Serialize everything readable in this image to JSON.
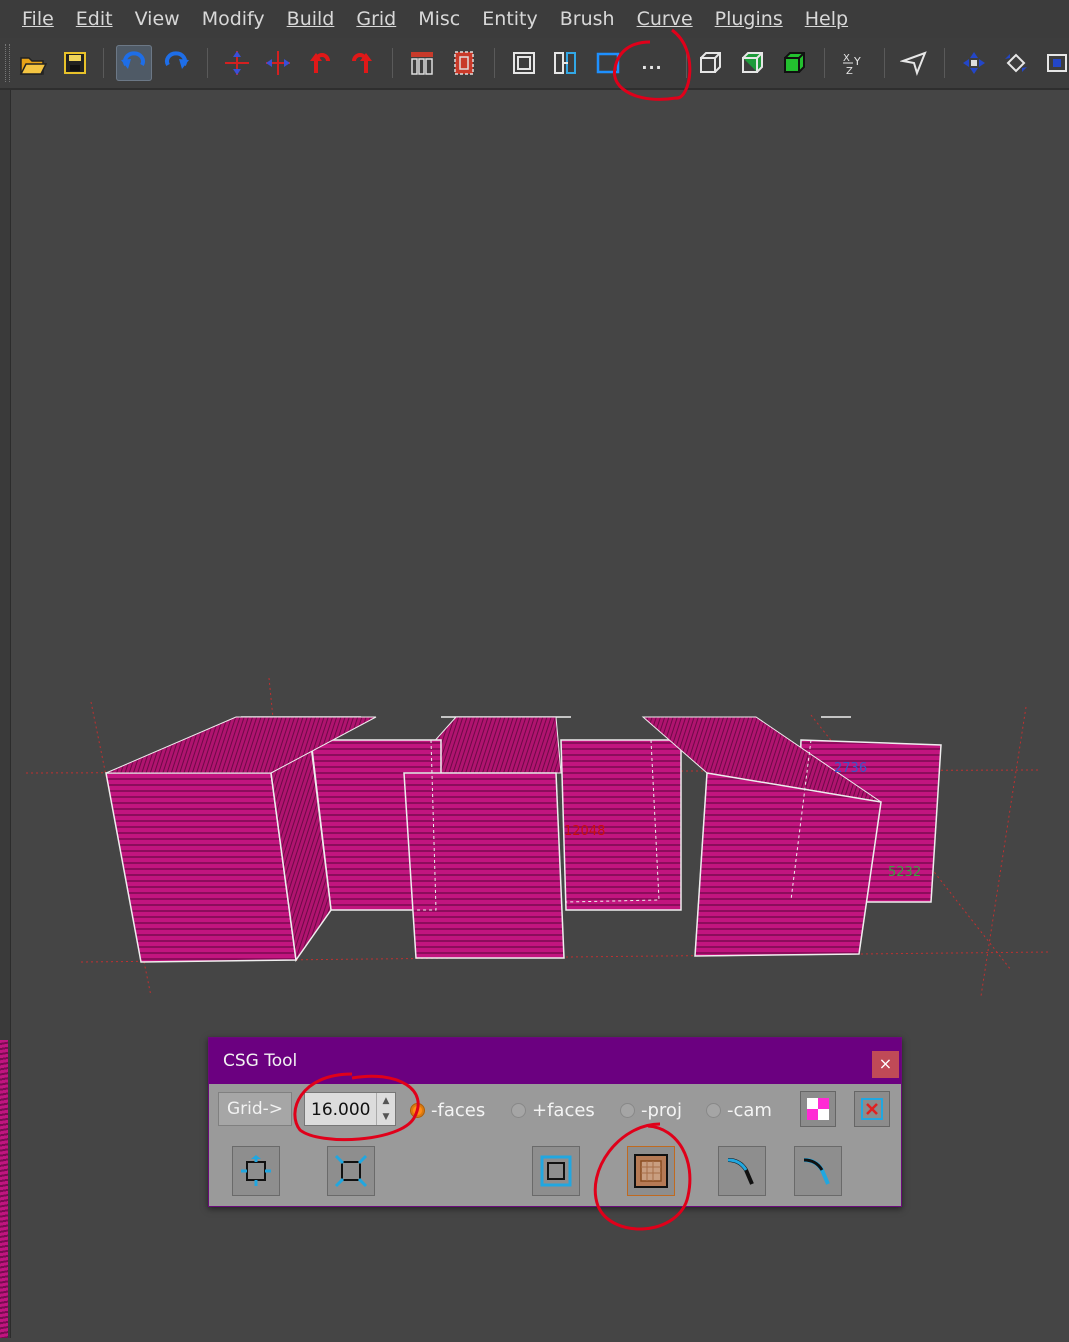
{
  "menu": [
    {
      "label": "File"
    },
    {
      "label": "Edit"
    },
    {
      "label": "View"
    },
    {
      "label": "Modify"
    },
    {
      "label": "Build"
    },
    {
      "label": "Grid"
    },
    {
      "label": "Misc"
    },
    {
      "label": "Entity"
    },
    {
      "label": "Brush"
    },
    {
      "label": "Curve"
    },
    {
      "label": "Plugins"
    },
    {
      "label": "Help"
    }
  ],
  "toolbar": {
    "more_label": "...",
    "icons": [
      "open-icon",
      "save-icon",
      "undo-icon",
      "redo-icon",
      "flip-x-icon",
      "flip-y-icon",
      "rotate-left-icon",
      "rotate-right-icon",
      "csg-subtract-icon",
      "csg-merge-icon",
      "clipper-icon",
      "select-icon",
      "region-icon",
      "more-tools",
      "cube-wire-icon",
      "cube-shaded-icon",
      "cube-green-icon",
      "xyz-view-icon",
      "camera-icon",
      "move-icon",
      "rotate-icon",
      "scale-icon"
    ]
  },
  "viewport": {
    "labels": {
      "red": "12048",
      "blue": "2736",
      "green": "5232"
    },
    "brush_color": "#c2157f"
  },
  "csg": {
    "title": "CSG Tool",
    "close": "×",
    "grid_button": "Grid->",
    "offset_value": "16.000",
    "options": [
      {
        "label": "-faces",
        "selected": true
      },
      {
        "label": "+faces",
        "selected": false
      },
      {
        "label": "-proj",
        "selected": false
      },
      {
        "label": "-cam",
        "selected": false
      }
    ]
  },
  "colors": {
    "titlebar": "#6b0080",
    "annotation": "#e0001a",
    "accent_orange": "#d97a1a"
  }
}
